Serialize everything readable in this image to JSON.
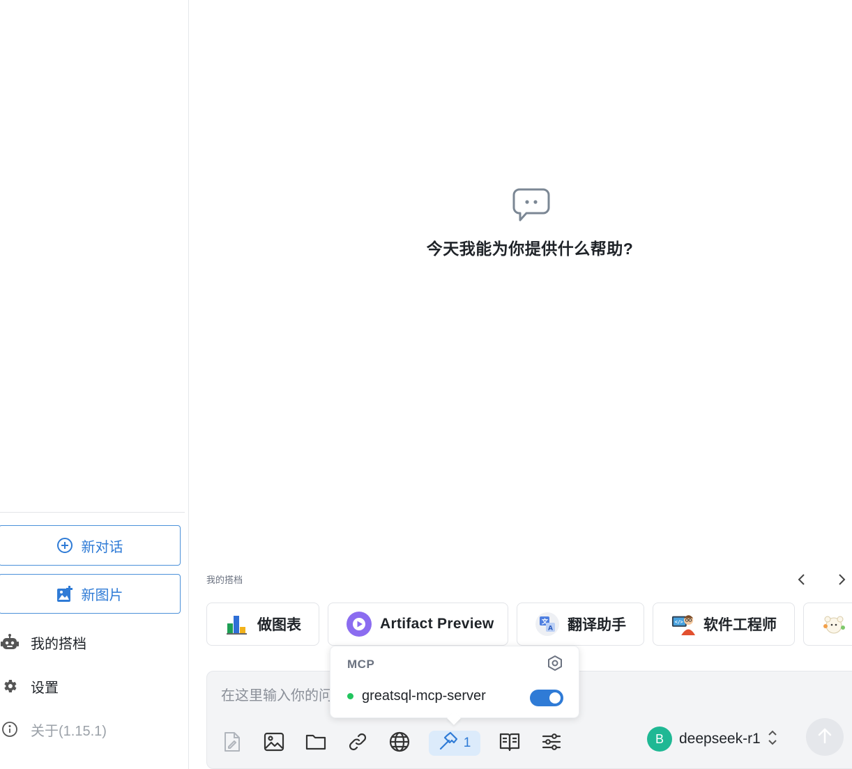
{
  "sidebar": {
    "new_chat_label": "新对话",
    "new_image_label": "新图片",
    "partners_label": "我的搭档",
    "settings_label": "设置",
    "about_label": "关于(1.15.1)"
  },
  "main": {
    "welcome_title": "今天我能为你提供什么帮助?",
    "partners_section_label": "我的搭档",
    "partners": [
      {
        "name": "做图表",
        "icon": "bar-chart-icon"
      },
      {
        "name": "Artifact Preview",
        "icon": "play-circle-icon"
      },
      {
        "name": "翻译助手",
        "icon": "translate-icon"
      },
      {
        "name": "软件工程师",
        "icon": "developer-avatar-icon"
      },
      {
        "name": "",
        "icon": "mascot-avatar-icon"
      }
    ]
  },
  "input": {
    "placeholder": "在这里输入你的问题",
    "mcp_count": "1",
    "model_avatar_letter": "B",
    "model_name": "deepseek-r1"
  },
  "mcp_popover": {
    "title": "MCP",
    "server_name": "greatsql-mcp-server",
    "server_enabled": true,
    "status_color": "#22c55e"
  },
  "colors": {
    "accent": "#2f7bd6",
    "model_avatar": "#1fb894"
  }
}
